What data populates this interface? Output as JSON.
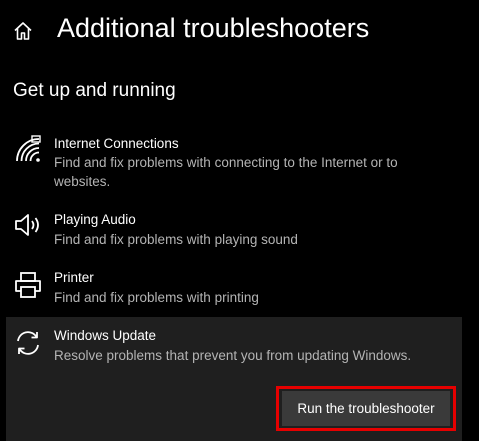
{
  "header": {
    "home_icon": "home-icon",
    "title": "Additional troubleshooters"
  },
  "section": {
    "title": "Get up and running"
  },
  "items": [
    {
      "icon": "wifi-icon",
      "name": "Internet Connections",
      "description": "Find and fix problems with connecting to the Internet or to websites."
    },
    {
      "icon": "speaker-icon",
      "name": "Playing Audio",
      "description": "Find and fix problems with playing sound"
    },
    {
      "icon": "printer-icon",
      "name": "Printer",
      "description": "Find and fix problems with printing"
    },
    {
      "icon": "refresh-icon",
      "name": "Windows Update",
      "description": "Resolve problems that prevent you from updating Windows.",
      "selected": true,
      "button_label": "Run the troubleshooter"
    }
  ],
  "colors": {
    "background": "#000000",
    "selected_item_background": "#1f1f1f",
    "button_background": "#3a3a3a",
    "highlight_outline": "#e60000",
    "secondary_text": "#b4b4b4"
  }
}
